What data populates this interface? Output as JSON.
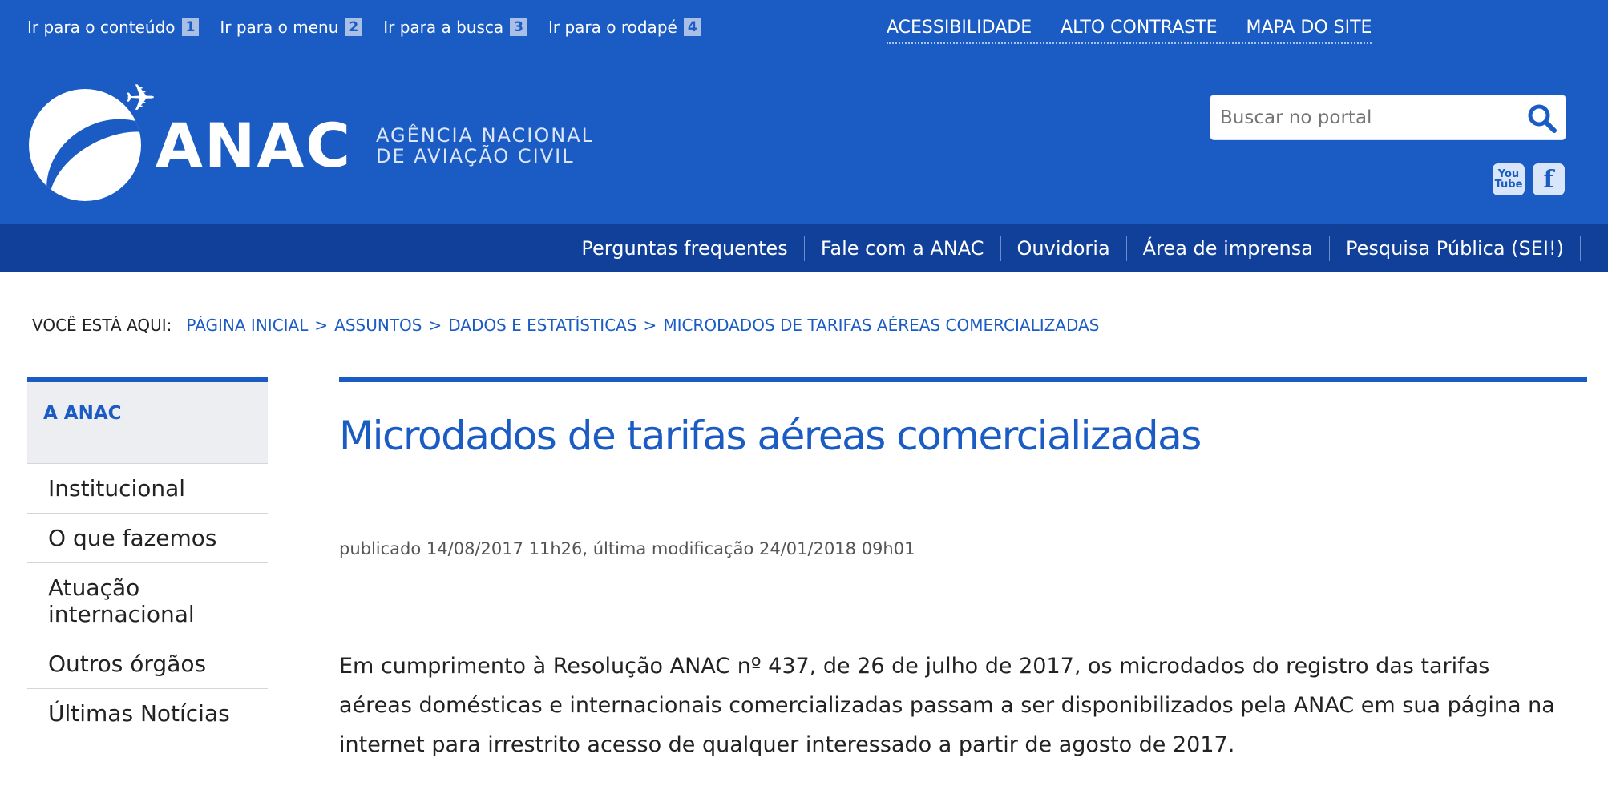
{
  "accessibility_bar": [
    {
      "label": "Ir para o conteúdo",
      "key": "1"
    },
    {
      "label": "Ir para o menu",
      "key": "2"
    },
    {
      "label": "Ir para a busca",
      "key": "3"
    },
    {
      "label": "Ir para o rodapé",
      "key": "4"
    }
  ],
  "top_links": [
    "ACESSIBILIDADE",
    "ALTO CONTRASTE",
    "MAPA DO SITE"
  ],
  "logo": {
    "acronym": "ANAC",
    "line1": "AGÊNCIA NACIONAL",
    "line2": "DE AVIAÇÃO CIVIL"
  },
  "search": {
    "placeholder": "Buscar no portal"
  },
  "social": {
    "youtube_line1": "You",
    "youtube_line2": "Tube",
    "facebook": "f"
  },
  "nav": [
    "Perguntas frequentes",
    "Fale com a ANAC",
    "Ouvidoria",
    "Área de imprensa",
    "Pesquisa Pública (SEI!)"
  ],
  "breadcrumb": {
    "label": "VOCÊ ESTÁ AQUI:",
    "items": [
      "PÁGINA INICIAL",
      "ASSUNTOS",
      "DADOS E ESTATÍSTICAS",
      "MICRODADOS DE TARIFAS AÉREAS COMERCIALIZADAS"
    ],
    "separator": ">"
  },
  "sidebar": {
    "heading": "A ANAC",
    "items": [
      "Institucional",
      "O que fazemos",
      "Atuação internacional",
      "Outros órgãos",
      "Últimas Notícias"
    ]
  },
  "content": {
    "title": "Microdados de tarifas aéreas comercializadas",
    "meta": "publicado 14/08/2017 11h26, última modificação 24/01/2018 09h01",
    "paragraph": "Em cumprimento à Resolução ANAC nº 437, de 26 de julho de 2017, os microdados do registro das tarifas aéreas domésticas e internacionais comercializadas passam a ser disponibilizados pela ANAC em sua página na internet para irrestrito acesso de qualquer interessado a partir de agosto de 2017."
  },
  "colors": {
    "brand_blue": "#1a5bc4",
    "nav_dark_blue": "#10409a"
  }
}
